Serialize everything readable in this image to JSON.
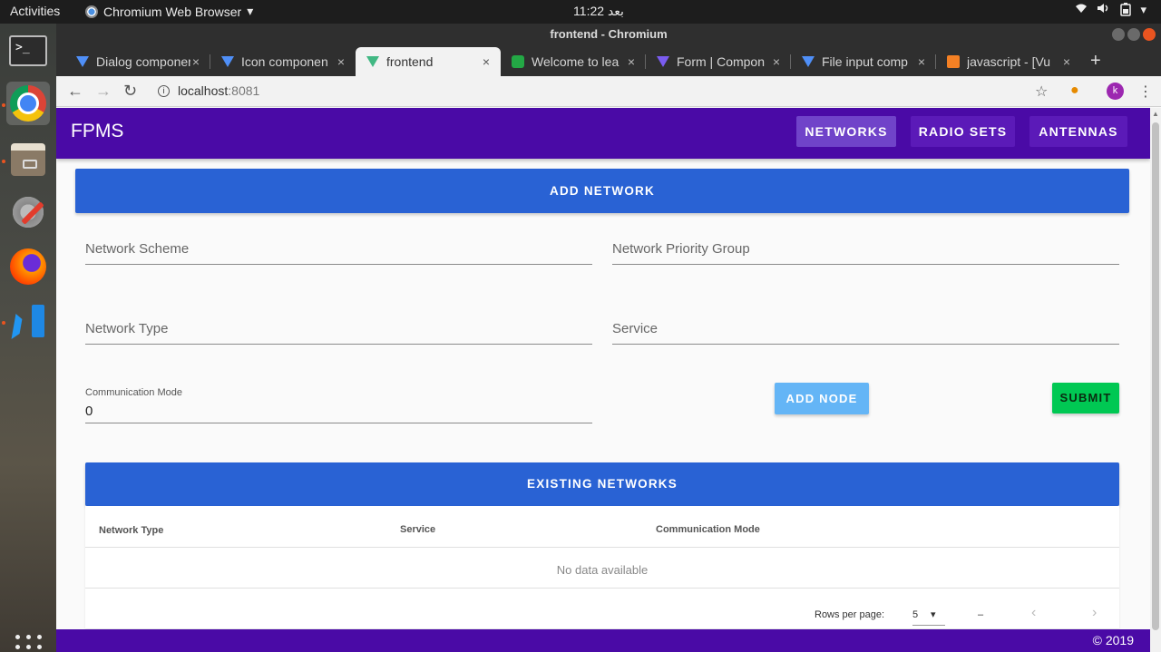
{
  "os": {
    "activities": "Activities",
    "app_menu": "Chromium Web Browser",
    "clock": "11:22 بعد",
    "tray": [
      "wifi-icon",
      "volume-icon",
      "battery-icon",
      "power-icon"
    ]
  },
  "dock": {
    "apps": [
      "terminal-icon",
      "chromium-icon",
      "files-icon",
      "settings-icon",
      "firefox-icon",
      "vscode-icon",
      "app-grid-icon"
    ]
  },
  "window": {
    "title": "frontend - Chromium"
  },
  "tabs": [
    {
      "title": "Dialog componen",
      "icon": "vue-icon"
    },
    {
      "title": "Icon componen",
      "icon": "vue-icon"
    },
    {
      "title": "frontend",
      "icon": "vue-icon"
    },
    {
      "title": "Welcome to lea",
      "icon": "web-icon"
    },
    {
      "title": "Form | Compon",
      "icon": "vue-icon"
    },
    {
      "title": "File input comp",
      "icon": "vue-icon"
    },
    {
      "title": "javascript - [Vu",
      "icon": "stackoverflow-icon"
    }
  ],
  "omnibox": {
    "host": "localhost",
    "port": ":8081"
  },
  "profile_initial": "k",
  "app": {
    "brand": "FPMS",
    "nav": [
      "NETWORKS",
      "RADIO SETS",
      "ANTENNAS"
    ],
    "add_network_label": "ADD NETWORK",
    "fields": {
      "network_scheme": "Network Scheme",
      "network_priority_group": "Network Priority Group",
      "network_type": "Network Type",
      "service": "Service",
      "communication_mode_label": "Communication Mode",
      "communication_mode_value": "0"
    },
    "add_node_label": "ADD NODE",
    "submit_label": "SUBMIT",
    "existing_networks_label": "EXISTING NETWORKS",
    "table": {
      "headers": [
        "Network Type",
        "Service",
        "Communication Mode"
      ],
      "empty_text": "No data available",
      "rows_per_page_label": "Rows per page:",
      "rows_per_page_value": "5",
      "page_range": "–"
    },
    "footer": "© 2019"
  },
  "colors": {
    "appbar": "#4a0aa6",
    "primary_blue": "#2962d4",
    "add_node": "#64b5f6",
    "submit": "#00c853"
  }
}
